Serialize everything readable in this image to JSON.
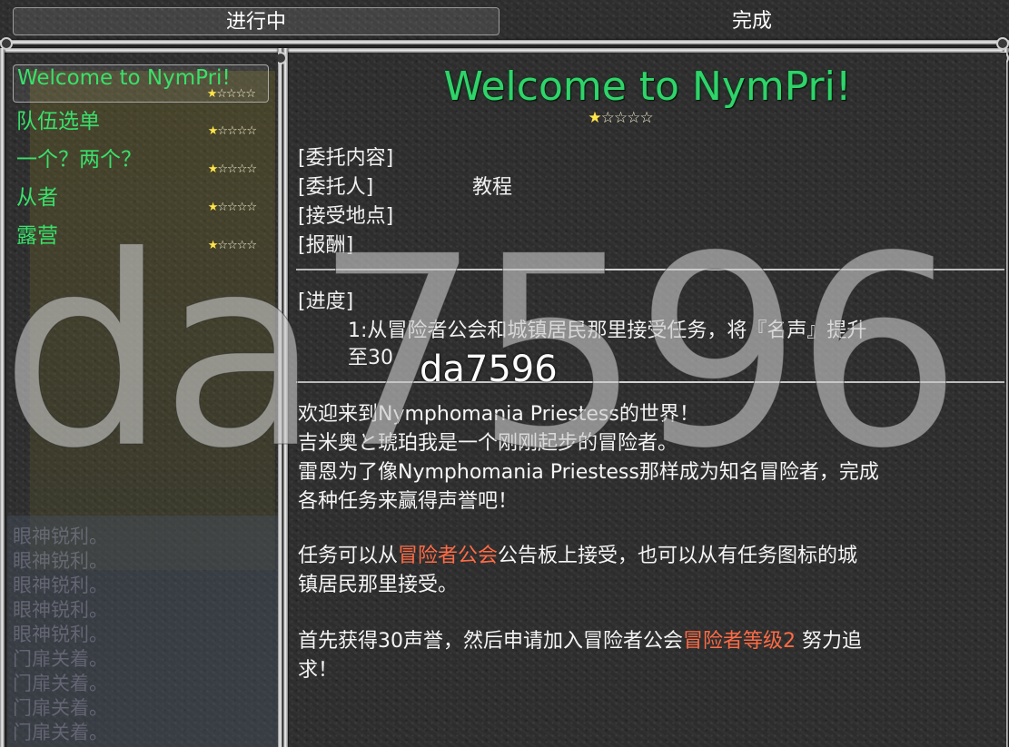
{
  "tabs": [
    {
      "label": "进行中",
      "active": true
    },
    {
      "label": "完成",
      "active": false
    }
  ],
  "quest_list": [
    {
      "name": "Welcome to NymPri!",
      "stars": 1,
      "max_stars": 5,
      "selected": true
    },
    {
      "name": "队伍选单",
      "stars": 1,
      "max_stars": 5,
      "selected": false
    },
    {
      "name": "一个？两个？",
      "stars": 1,
      "max_stars": 5,
      "selected": false
    },
    {
      "name": "从者",
      "stars": 1,
      "max_stars": 5,
      "selected": false
    },
    {
      "name": "露营",
      "stars": 1,
      "max_stars": 5,
      "selected": false
    }
  ],
  "background_text": [
    "眼神锐利。",
    "眼神锐利。",
    "眼神锐利。",
    "眼神锐利。",
    "眼神锐利。",
    "门扉关着。",
    "门扉关着。",
    "门扉关着。",
    "门扉关着。"
  ],
  "detail": {
    "title": "Welcome to NymPri!",
    "stars": 1,
    "max_stars": 5,
    "fields": {
      "content_label": "[委托内容]",
      "client_label": "[委托人]",
      "client_value": "教程",
      "location_label": "[接受地点]",
      "reward_label": "[报酬]"
    },
    "progress_label": "[进度]",
    "progress_lines": [
      "1:从冒险者公会和城镇居民那里接受任务，将『名声』提升",
      "至30"
    ],
    "description": {
      "line1": "欢迎来到Nymphomania Priestess的世界！",
      "line2": "吉米奥と琥珀我是一个刚刚起步的冒险者。",
      "line3": "雷恩为了像Nymphomania Priestess那样成为知名冒险者，完成",
      "line4": "各种任务来赢得声誉吧！",
      "line5_pre": "任务可以从",
      "line5_hl": "冒险者公会",
      "line5_post": "公告板上接受，也可以从有任务图标的城",
      "line6": "镇居民那里接受。",
      "line7_pre": "首先获得30声誉，然后申请加入冒险者公会",
      "line7_hl": "冒险者等级2",
      "line7_post": " 努力追",
      "line8": "求！"
    }
  },
  "watermark": {
    "big": "da7596",
    "small": "da7596"
  },
  "colors": {
    "quest_green": "#39e06a",
    "highlight": "#ff6b45",
    "star": "#ffe54a"
  }
}
